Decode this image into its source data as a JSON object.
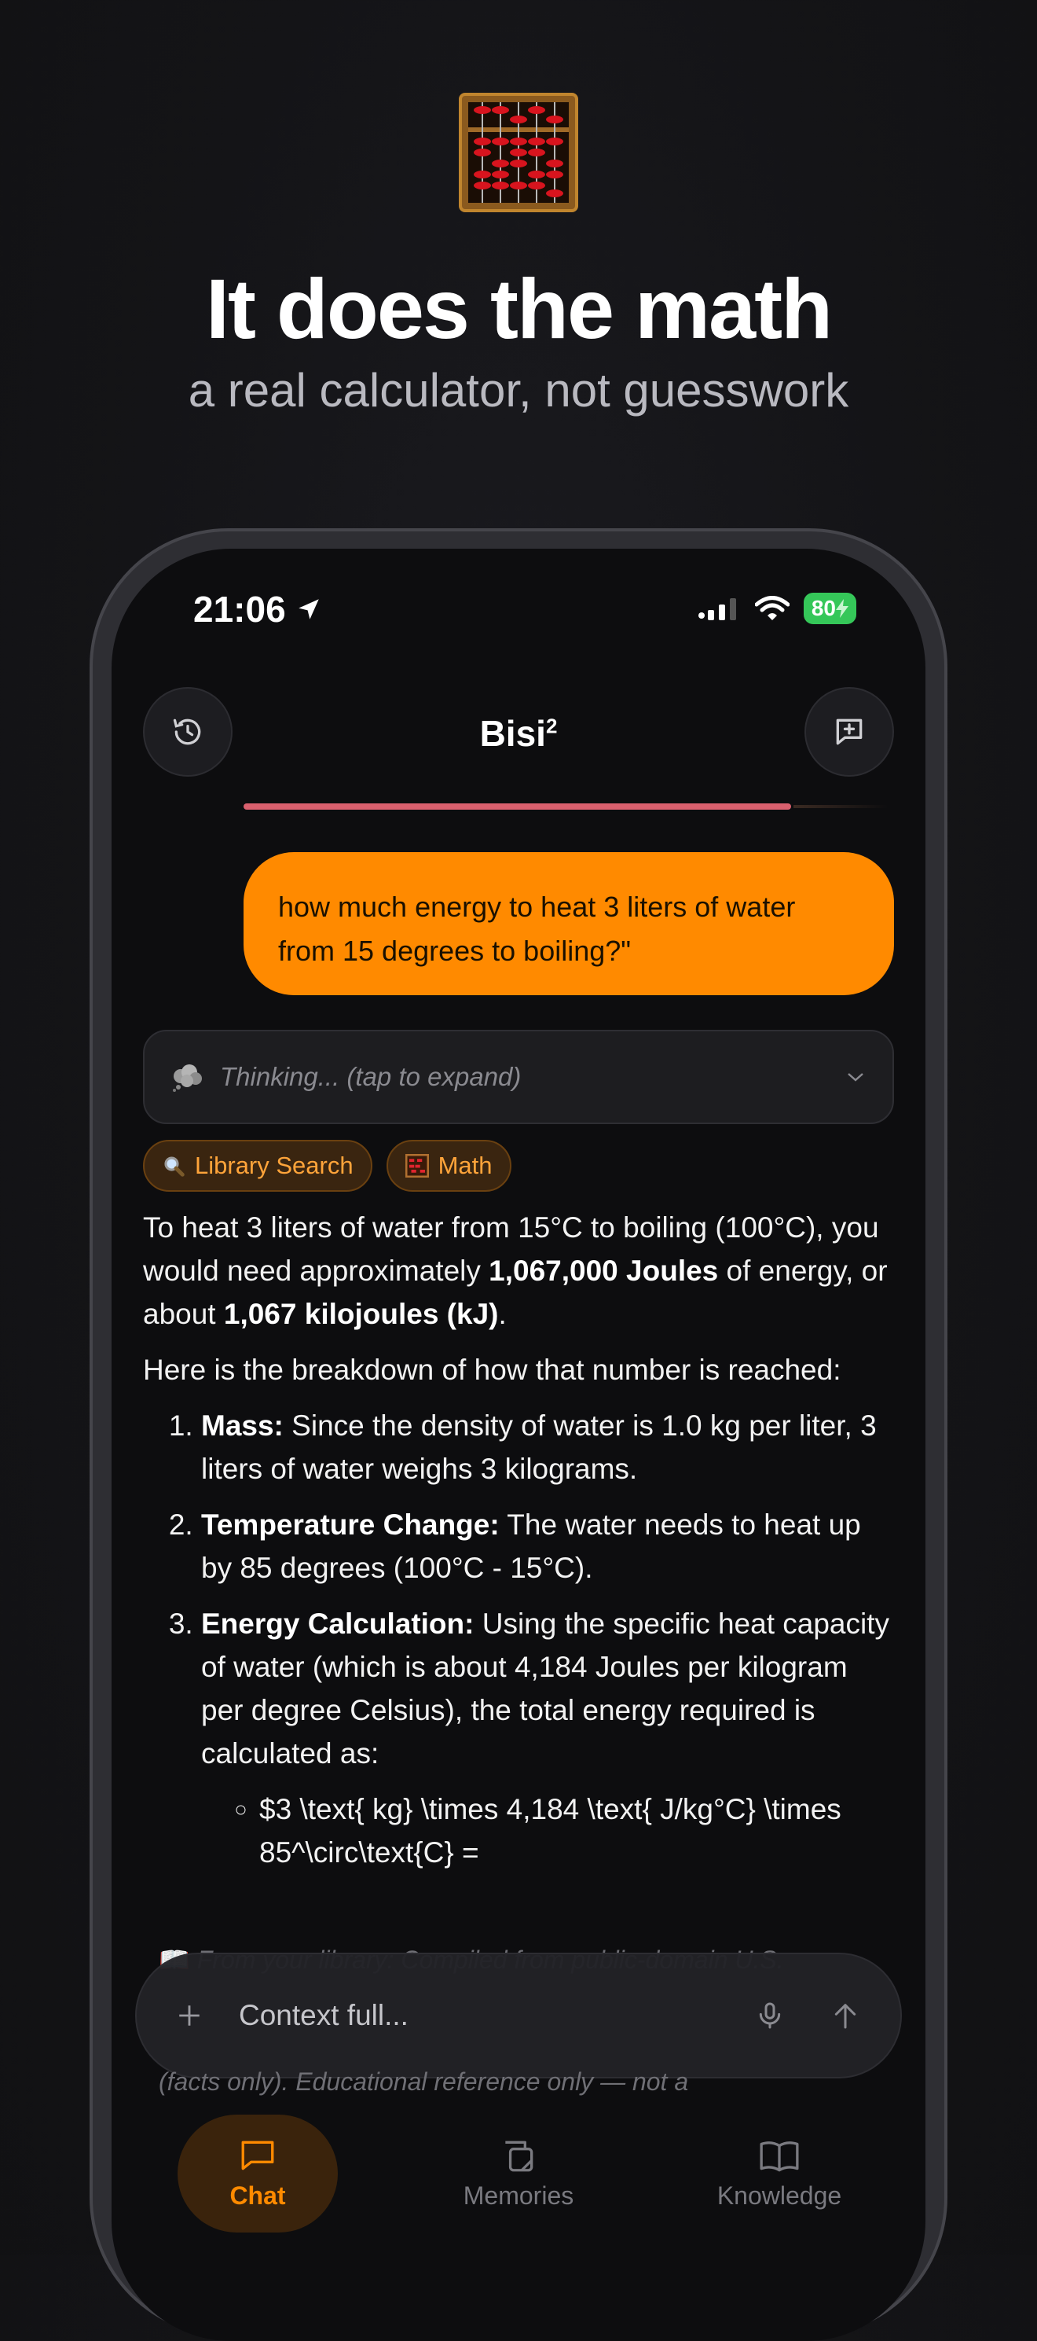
{
  "hero": {
    "title": "It does the math",
    "subtitle": "a real calculator, not guesswork",
    "logo_icon": "abacus-icon"
  },
  "status_bar": {
    "time": "21:06",
    "battery": "80"
  },
  "header": {
    "title": "Bisi",
    "title_superscript": "2",
    "history_icon": "history-icon",
    "new_chat_icon": "new-chat-icon",
    "progress_fraction": 0.85,
    "progress_color": "#d9606e"
  },
  "chat": {
    "user_message": "how much energy to heat 3 liters of water from 15 degrees to boiling?\"",
    "thinking_label": "Thinking... (tap to expand)",
    "tools": [
      {
        "label": "Library Search",
        "icon": "magnifier-icon"
      },
      {
        "label": "Math",
        "icon": "abacus-icon"
      }
    ],
    "answer": {
      "p1_a": "To heat 3 liters of water from 15°C to boiling (100°C), you would need approximately ",
      "p1_b": "1,067,000 Joules",
      "p1_c": " of energy, or about ",
      "p1_d": "1,067 kilojoules (kJ)",
      "p1_e": ".",
      "p2": "Here is the breakdown of how that number is reached:",
      "steps": [
        {
          "label": "Mass:",
          "text": " Since the density of water is 1.0 kg per liter, 3 liters of water weighs 3 kilograms."
        },
        {
          "label": "Temperature Change:",
          "text": " The water needs to heat up by 85 degrees (100°C - 15°C)."
        },
        {
          "label": "Energy Calculation:",
          "text": " Using the specific heat capacity of water (which is about 4,184 Joules per kilogram per degree Celsius), the total energy required is calculated as:"
        }
      ],
      "formula": "$3 \\text{ kg} \\times 4,184 \\text{ J/kg°C} \\times 85^\\circ\\text{C} ="
    },
    "library_note_top": "From your library: Compiled from public-domain U.S.",
    "library_note_bottom": "(facts only). Educational reference only — not a"
  },
  "input": {
    "placeholder": "Context full...",
    "plus_icon": "plus-icon",
    "mic_icon": "microphone-icon",
    "send_icon": "send-arrow-icon"
  },
  "tabs": [
    {
      "label": "Chat",
      "icon": "chat-icon",
      "active": true
    },
    {
      "label": "Memories",
      "icon": "memories-icon",
      "active": false
    },
    {
      "label": "Knowledge",
      "icon": "book-icon",
      "active": false
    }
  ],
  "colors": {
    "accent": "#ff8a00",
    "background": "#111113",
    "battery": "#35c759"
  }
}
